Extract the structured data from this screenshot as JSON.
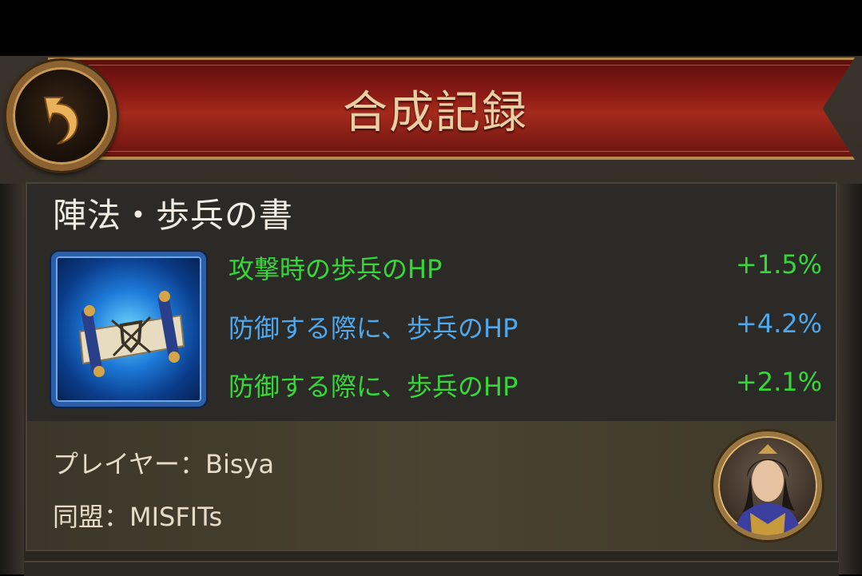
{
  "header": {
    "title": "合成記録",
    "back_icon": "back-arrow-icon"
  },
  "item": {
    "name": "陣法・歩兵の書",
    "icon": "scroll-icon"
  },
  "stats": [
    {
      "label": "攻撃時の歩兵のHP",
      "value": "+1.5%",
      "color": "#35d838"
    },
    {
      "label": "防御する際に、歩兵のHP",
      "value": "+4.2%",
      "color": "#4ea8ee"
    },
    {
      "label": "防御する際に、歩兵のHP",
      "value": "+2.1%",
      "color": "#35d838"
    }
  ],
  "player": {
    "player_line": "プレイヤー：Bisya",
    "alliance_line": "同盟：MISFITs",
    "avatar": "player-portrait-avatar"
  }
}
